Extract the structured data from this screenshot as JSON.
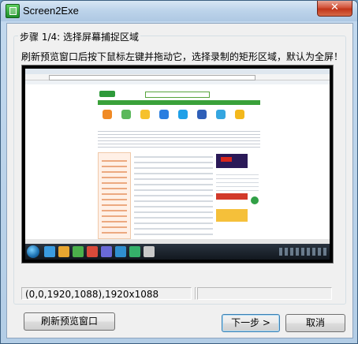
{
  "window": {
    "title": "Screen2Exe",
    "close_glyph": "✕",
    "app_icon": "screen2exe-app-icon"
  },
  "step": {
    "legend": "步骤 1/4: 选择屏幕捕捉区域",
    "instruction": "刷新预览窗口后按下鼠标左键并拖动它，选择录制的矩形区域，默认为全屏！"
  },
  "status": {
    "region": "(0,0,1920,1088),1920x1088",
    "pane2": "",
    "pane3": ""
  },
  "buttons": {
    "refresh": "刷新预览窗口",
    "next": "下一步 >",
    "cancel": "取消"
  },
  "colors": {
    "titlebar": "#bcd3ea",
    "close": "#c1351a",
    "client_bg": "#f0f0f0"
  }
}
